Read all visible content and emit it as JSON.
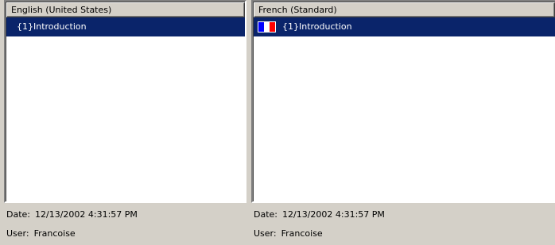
{
  "left_pane": {
    "header": "English (United States)",
    "items": [
      {
        "label": "{1}Introduction",
        "selected": true
      }
    ],
    "date_label": "Date:",
    "date_value": "12/13/2002 4:31:57 PM",
    "user_label": "User:",
    "user_value": "Francoise"
  },
  "right_pane": {
    "header": "French (Standard)",
    "items": [
      {
        "label": "{1}Introduction",
        "selected": true,
        "icon": "french-flag-icon"
      }
    ],
    "date_label": "Date:",
    "date_value": "12/13/2002 4:31:57 PM",
    "user_label": "User:",
    "user_value": "Francoise"
  },
  "colors": {
    "window_bg": "#d4d0c8",
    "selection_bg": "#0a246a",
    "selection_text": "#ffffff",
    "flag_blue": "#0000ff",
    "flag_white": "#ffffff",
    "flag_red": "#ff0000"
  }
}
